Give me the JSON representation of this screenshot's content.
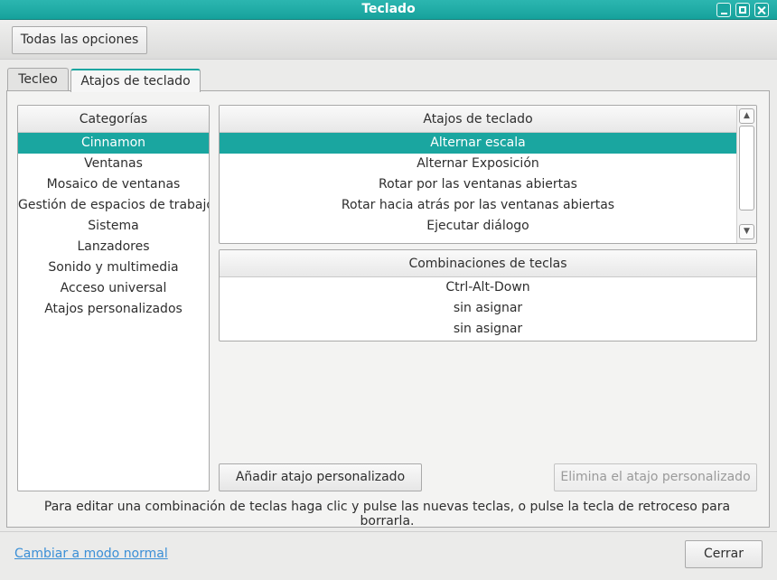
{
  "window": {
    "title": "Teclado"
  },
  "toolbar": {
    "all_settings_label": "Todas las opciones"
  },
  "tabs": [
    {
      "label": "Tecleo",
      "active": false
    },
    {
      "label": "Atajos de teclado",
      "active": true
    }
  ],
  "categories": {
    "header": "Categorías",
    "items": [
      "Cinnamon",
      "Ventanas",
      "Mosaico de ventanas",
      "Gestión de espacios de trabajo",
      "Sistema",
      "Lanzadores",
      "Sonido y multimedia",
      "Acceso universal",
      "Atajos personalizados"
    ],
    "selected_index": 0
  },
  "shortcuts": {
    "header": "Atajos de teclado",
    "items": [
      "Alternar escala",
      "Alternar Exposición",
      "Rotar por las ventanas abiertas",
      "Rotar hacia atrás por las ventanas abiertas",
      "Ejecutar diálogo"
    ],
    "selected_index": 0
  },
  "keybindings": {
    "header": "Combinaciones de teclas",
    "items": [
      "Ctrl-Alt-Down",
      "sin asignar",
      "sin asignar"
    ]
  },
  "buttons": {
    "add_custom": "Añadir atajo personalizado",
    "remove_custom": "Elimina el atajo personalizado",
    "close": "Cerrar"
  },
  "hint": "Para editar una combinación de teclas haga clic y pulse las nuevas teclas, o pulse la tecla de retroceso para borrarla.",
  "footer": {
    "normal_mode_link": "Cambiar a modo normal"
  },
  "colors": {
    "accent": "#1aa6a0",
    "link": "#3b8fd6"
  }
}
